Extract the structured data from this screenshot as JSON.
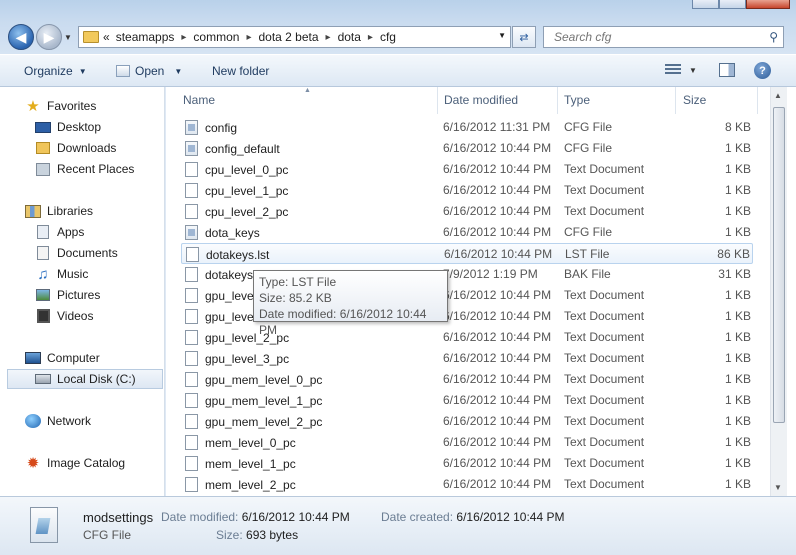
{
  "window": {
    "controls": [
      "minimize",
      "maximize",
      "close"
    ]
  },
  "address": {
    "overflow": "«",
    "crumbs": [
      "steamapps",
      "common",
      "dota 2 beta",
      "dota",
      "cfg"
    ]
  },
  "search": {
    "placeholder": "Search cfg"
  },
  "toolbar": {
    "organize_label": "Organize",
    "open_label": "Open",
    "new_folder_label": "New folder"
  },
  "nav": {
    "favorites": "Favorites",
    "desktop": "Desktop",
    "downloads": "Downloads",
    "recent": "Recent Places",
    "libraries": "Libraries",
    "apps": "Apps",
    "documents": "Documents",
    "music": "Music",
    "pictures": "Pictures",
    "videos": "Videos",
    "computer": "Computer",
    "local_disk": "Local Disk (C:)",
    "network": "Network",
    "image_catalog": "Image Catalog"
  },
  "columns": {
    "name": "Name",
    "date": "Date modified",
    "type": "Type",
    "size": "Size"
  },
  "files": [
    {
      "name": "config",
      "date": "6/16/2012 11:31 PM",
      "type": "CFG File",
      "size": "8 KB",
      "icon": "cfg-file-icon"
    },
    {
      "name": "config_default",
      "date": "6/16/2012 10:44 PM",
      "type": "CFG File",
      "size": "1 KB",
      "icon": "cfg-file-icon"
    },
    {
      "name": "cpu_level_0_pc",
      "date": "6/16/2012 10:44 PM",
      "type": "Text Document",
      "size": "1 KB",
      "icon": "text-file-icon"
    },
    {
      "name": "cpu_level_1_pc",
      "date": "6/16/2012 10:44 PM",
      "type": "Text Document",
      "size": "1 KB",
      "icon": "text-file-icon"
    },
    {
      "name": "cpu_level_2_pc",
      "date": "6/16/2012 10:44 PM",
      "type": "Text Document",
      "size": "1 KB",
      "icon": "text-file-icon"
    },
    {
      "name": "dota_keys",
      "date": "6/16/2012 10:44 PM",
      "type": "CFG File",
      "size": "1 KB",
      "icon": "cfg-file-icon"
    },
    {
      "name": "dotakeys.lst",
      "date": "6/16/2012 10:44 PM",
      "type": "LST File",
      "size": "86 KB",
      "icon": "file-icon"
    },
    {
      "name": "dotakeys",
      "date": "7/9/2012 1:19 PM",
      "type": "BAK File",
      "size": "31 KB",
      "icon": "file-icon"
    },
    {
      "name": "gpu_level",
      "date": "6/16/2012 10:44 PM",
      "type": "Text Document",
      "size": "1 KB",
      "icon": "text-file-icon"
    },
    {
      "name": "gpu_level",
      "date": "6/16/2012 10:44 PM",
      "type": "Text Document",
      "size": "1 KB",
      "icon": "text-file-icon"
    },
    {
      "name": "gpu_level_2_pc",
      "date": "6/16/2012 10:44 PM",
      "type": "Text Document",
      "size": "1 KB",
      "icon": "text-file-icon"
    },
    {
      "name": "gpu_level_3_pc",
      "date": "6/16/2012 10:44 PM",
      "type": "Text Document",
      "size": "1 KB",
      "icon": "text-file-icon"
    },
    {
      "name": "gpu_mem_level_0_pc",
      "date": "6/16/2012 10:44 PM",
      "type": "Text Document",
      "size": "1 KB",
      "icon": "text-file-icon"
    },
    {
      "name": "gpu_mem_level_1_pc",
      "date": "6/16/2012 10:44 PM",
      "type": "Text Document",
      "size": "1 KB",
      "icon": "text-file-icon"
    },
    {
      "name": "gpu_mem_level_2_pc",
      "date": "6/16/2012 10:44 PM",
      "type": "Text Document",
      "size": "1 KB",
      "icon": "text-file-icon"
    },
    {
      "name": "mem_level_0_pc",
      "date": "6/16/2012 10:44 PM",
      "type": "Text Document",
      "size": "1 KB",
      "icon": "text-file-icon"
    },
    {
      "name": "mem_level_1_pc",
      "date": "6/16/2012 10:44 PM",
      "type": "Text Document",
      "size": "1 KB",
      "icon": "text-file-icon"
    },
    {
      "name": "mem_level_2_pc",
      "date": "6/16/2012 10:44 PM",
      "type": "Text Document",
      "size": "1 KB",
      "icon": "text-file-icon"
    }
  ],
  "tooltip": {
    "type": "Type: LST File",
    "size": "Size: 85.2 KB",
    "modified": "Date modified: 6/16/2012 10:44 PM"
  },
  "details": {
    "name": "modsettings",
    "type": "CFG File",
    "modified_label": "Date modified:",
    "modified_value": "6/16/2012 10:44 PM",
    "created_label": "Date created:",
    "created_value": "6/16/2012 10:44 PM",
    "size_label": "Size:",
    "size_value": "693 bytes"
  },
  "colors": {
    "accent": "#2a64b0",
    "hover_border": "#b9d3ee"
  }
}
